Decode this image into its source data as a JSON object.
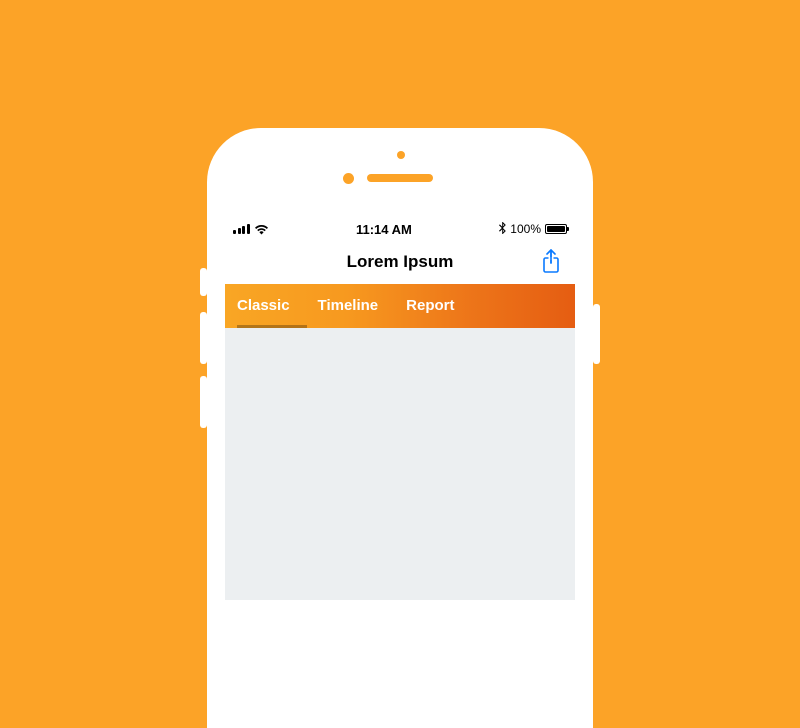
{
  "status": {
    "time": "11:14 AM",
    "battery_pct": "100%"
  },
  "nav": {
    "title": "Lorem Ipsum"
  },
  "tabs": {
    "items": [
      "Classic",
      "Timeline",
      "Report"
    ],
    "active_index": 0
  },
  "colors": {
    "background": "#fca327",
    "tab_gradient_start": "#f9a624",
    "tab_gradient_end": "#e55d12",
    "accent_blue": "#0a7aff"
  }
}
